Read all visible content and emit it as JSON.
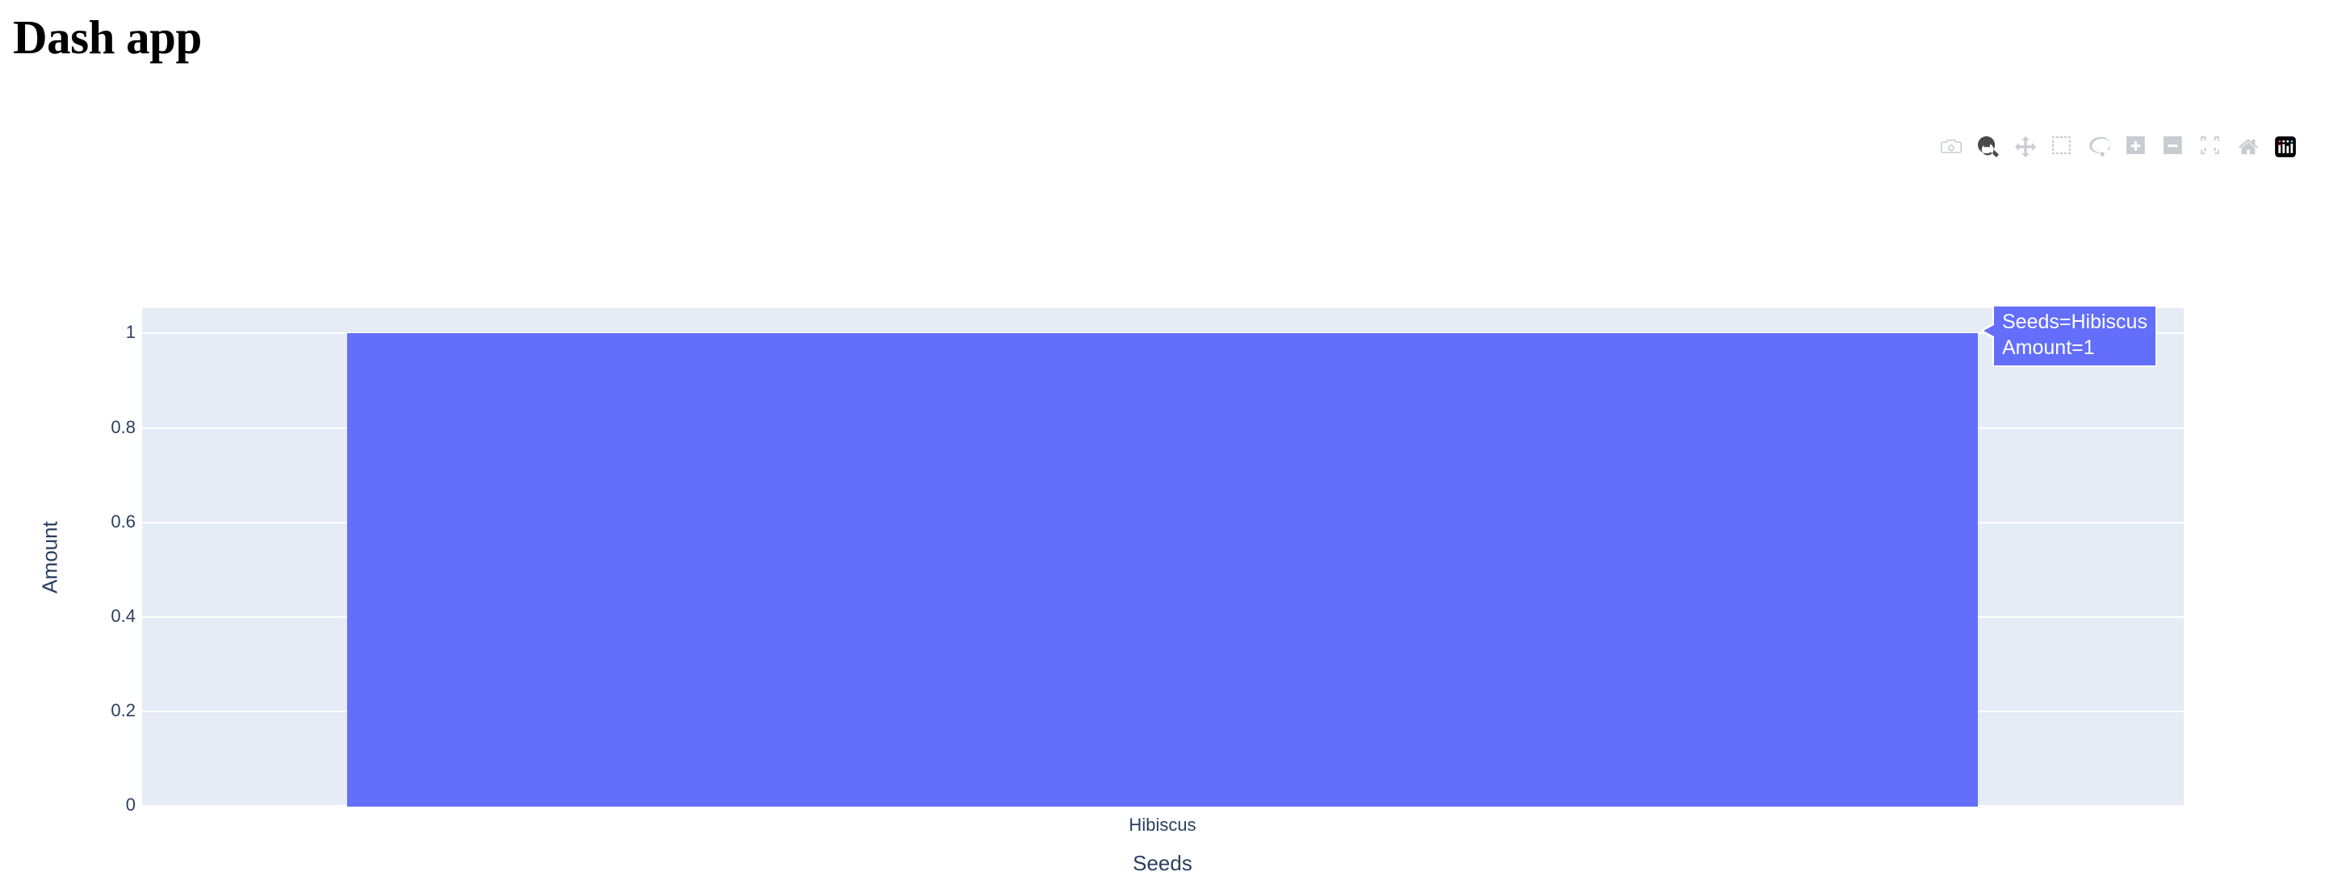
{
  "app": {
    "title": "Dash app"
  },
  "modebar": {
    "buttons": [
      {
        "name": "download-plot-icon",
        "label": "Download plot as a png",
        "active": false
      },
      {
        "name": "zoom-icon",
        "label": "Zoom",
        "active": true
      },
      {
        "name": "pan-icon",
        "label": "Pan",
        "active": false
      },
      {
        "name": "box-select-icon",
        "label": "Box Select",
        "active": false
      },
      {
        "name": "lasso-select-icon",
        "label": "Lasso Select",
        "active": false
      },
      {
        "name": "zoom-in-icon",
        "label": "Zoom in",
        "active": false
      },
      {
        "name": "zoom-out-icon",
        "label": "Zoom out",
        "active": false
      },
      {
        "name": "autoscale-icon",
        "label": "Autoscale",
        "active": false
      },
      {
        "name": "reset-axes-icon",
        "label": "Reset axes",
        "active": false
      },
      {
        "name": "plotly-logo-icon",
        "label": "Produced with Plotly",
        "active": false
      }
    ]
  },
  "chart_data": {
    "type": "bar",
    "title": "",
    "categories": [
      "Hibiscus"
    ],
    "values": [
      1
    ],
    "xlabel": "Seeds",
    "ylabel": "Amount",
    "ylim": [
      0,
      1
    ],
    "yticks": [
      "0",
      "0.2",
      "0.4",
      "0.6",
      "0.8",
      "1"
    ],
    "ytick_values": [
      0,
      0.2,
      0.4,
      0.6,
      0.8,
      1
    ],
    "xticks": [
      "Hibiscus"
    ],
    "grid": true,
    "legend": "none",
    "colors": {
      "bar": "#636EFA",
      "plot_background": "#E5ECF6",
      "paper_background": "#FFFFFF",
      "gridline": "#FFFFFF",
      "axis_text": "#2A3F5F"
    }
  },
  "tooltip": {
    "visible": true,
    "lines": [
      "Seeds=Hibiscus",
      "Amount=1"
    ],
    "line1": "Seeds=Hibiscus",
    "line2": "Amount=1",
    "background": "#636EFA",
    "text_color": "#FFFFFF"
  }
}
